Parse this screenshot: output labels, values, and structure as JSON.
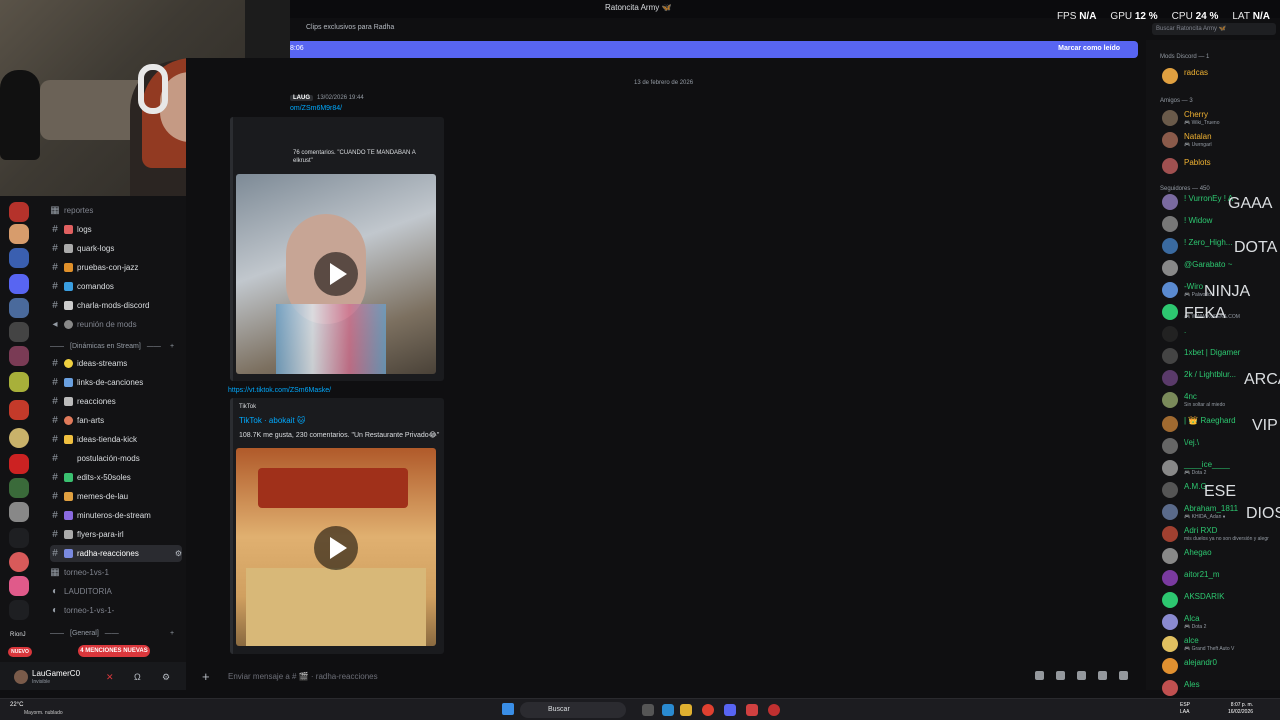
{
  "window": {
    "title": "Ratoncita Army 🦋"
  },
  "stats": [
    {
      "label": "FPS",
      "value": "N/A"
    },
    {
      "label": "GPU",
      "value": "12 %"
    },
    {
      "label": "CPU",
      "value": "24 %"
    },
    {
      "label": "LAT",
      "value": "N/A"
    }
  ],
  "channel_header": {
    "topic": "Clips exclusivos para Radha"
  },
  "new_messages": {
    "time": "8:06",
    "mark_read": "Marcar como leído"
  },
  "search": {
    "placeholder": "Buscar Ratoncita Army 🦋"
  },
  "channels": {
    "top_label": "reportes",
    "list": [
      {
        "name": "logs"
      },
      {
        "name": "quark-logs"
      },
      {
        "name": "pruebas-con-jazz"
      },
      {
        "name": "comandos"
      },
      {
        "name": "charla-mods-discord"
      },
      {
        "name": "reunión de mods"
      }
    ],
    "cat_dinamicas": "[Dinámicas en Stream]",
    "list2": [
      {
        "name": "ideas-streams"
      },
      {
        "name": "links-de-canciones"
      },
      {
        "name": "reacciones"
      },
      {
        "name": "fan-arts"
      },
      {
        "name": "ideas-tienda-kick"
      },
      {
        "name": "postulación-mods"
      },
      {
        "name": "edits-x-50soles"
      },
      {
        "name": "memes-de-lau"
      },
      {
        "name": "minuteros-de-stream"
      },
      {
        "name": "flyers-para-irl"
      },
      {
        "name": "radha-reacciones"
      },
      {
        "name": "torneo-1vs-1"
      },
      {
        "name": "LAUDITORIA"
      },
      {
        "name": "torneo-1-vs-1-"
      }
    ],
    "cat_general": "[General]",
    "mentions": "4 MENCIONES NUEVAS"
  },
  "rail": {
    "nuevo": "NUEVO",
    "rionj": "RíonJ"
  },
  "user": {
    "name": "LauGamerC0",
    "status": "Invisible"
  },
  "chat": {
    "date_separator": "13 de febrero de 2026",
    "author_tag": "LAUG",
    "timestamp": "13/02/2026 19:44",
    "link1": "om/ZSm6M9r84/",
    "embed1_desc1": "76 comentarios. \"CUANDO TE MANDABAN A",
    "embed1_desc2": "elkrust\"",
    "link2": "https://vt.tiktok.com/ZSm6Maske/",
    "embed2_provider": "TikTok",
    "embed2_author": "TikTok · abokait 🐱",
    "embed2_desc": "108.7K me gusta, 230 comentarios. \"Un Restaurante Privado😂\""
  },
  "input": {
    "placeholder": "Enviar mensaje a # 🎬 · radha-reacciones"
  },
  "members": {
    "groups": [
      {
        "title": "Mods Discord — 1"
      },
      {
        "title": "Amigos — 3"
      },
      {
        "title": "Seguidores — 450"
      }
    ],
    "list": [
      {
        "name": "radcas",
        "status": "",
        "color": "#f0b232"
      },
      {
        "name": "Cherry",
        "status": "🎮 Wiki_Trueno",
        "color": "#f0b232"
      },
      {
        "name": "Natalan",
        "status": "🎮 Uwrngarl",
        "color": "#f0b232"
      },
      {
        "name": "Pablots",
        "status": "",
        "color": "#f0b232"
      },
      {
        "name": "! VurronEy ! A",
        "status": "",
        "color": "#2dc770"
      },
      {
        "name": "! Widow",
        "status": "",
        "color": "#2dc770"
      },
      {
        "name": "! Zero_High...",
        "status": "",
        "color": "#2dc770"
      },
      {
        "name": "@Garabato ~",
        "status": "",
        "color": "#2dc770"
      },
      {
        "name": "-Wiro",
        "status": "🎮 Palworld",
        "color": "#2dc770"
      },
      {
        "name": "",
        "status": "🎮 WWW.KUFEKA.COM",
        "color": "#2dc770"
      },
      {
        "name": ".",
        "status": "",
        "color": "#2dc770"
      },
      {
        "name": "1xbet | Digamer",
        "status": "",
        "color": "#2dc770"
      },
      {
        "name": "2k / Lightblur...",
        "status": "",
        "color": "#2dc770"
      },
      {
        "name": "4nc",
        "status": "Sin soltar al miedo",
        "color": "#2dc770"
      },
      {
        "name": "| 👑 Raeghard",
        "status": "",
        "color": "#2dc770"
      },
      {
        "name": "\\/ej.\\",
        "status": "",
        "color": "#2dc770"
      },
      {
        "name": "____ice____",
        "status": "🎮 Dota 2",
        "color": "#2dc770"
      },
      {
        "name": "A.M.G",
        "status": "",
        "color": "#2dc770"
      },
      {
        "name": "Abraham_1811",
        "status": "🎮 KHIDA_Adan ♦",
        "color": "#2dc770"
      },
      {
        "name": "Adri RXD",
        "status": "mis duelos ya no son diversión y alegr",
        "color": "#2dc770"
      },
      {
        "name": "Ahegao",
        "status": "",
        "color": "#2dc770"
      },
      {
        "name": "aitor21_m",
        "status": "",
        "color": "#2dc770"
      },
      {
        "name": "AKSDARIK",
        "status": "",
        "color": "#2dc770"
      },
      {
        "name": "Alca",
        "status": "🎮 Dota 2",
        "color": "#2dc770"
      },
      {
        "name": "alce",
        "status": "🎮 Grand Theft Auto V",
        "color": "#2dc770"
      },
      {
        "name": "alejandr0",
        "status": "",
        "color": "#2dc770"
      },
      {
        "name": "Ales",
        "status": "",
        "color": "#2dc770"
      }
    ],
    "badges": [
      "GAAA",
      "DOTA",
      "NINJA",
      "FEKA",
      "ARCA",
      "VIP",
      "ESE",
      "DIOS"
    ]
  },
  "taskbar": {
    "temp": "22°C",
    "weather": "Mayorm. nublado",
    "search": "Buscar",
    "lang1": "ESP",
    "lang2": "LAA",
    "time": "8:07 p. m.",
    "date": "16/02/2026"
  },
  "colors": {
    "accent": "#5865f2",
    "link": "#00a8fc",
    "online": "#2dc770",
    "mention": "#da373c"
  }
}
